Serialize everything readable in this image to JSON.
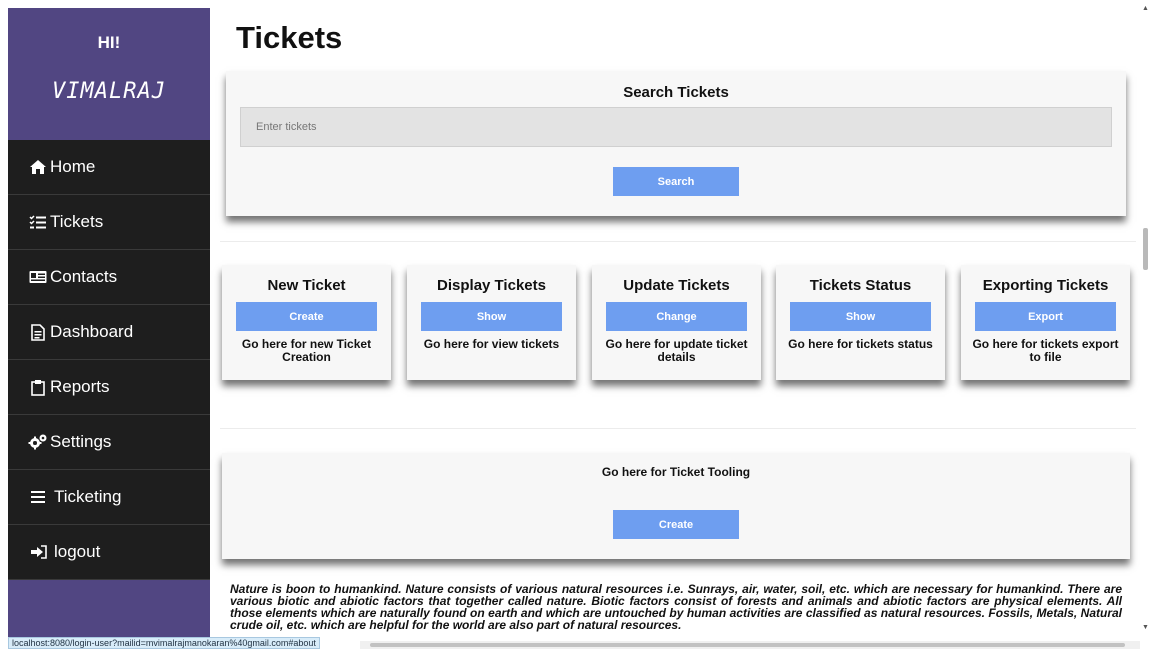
{
  "sidebar": {
    "greeting": "HI!",
    "username": "VIMALRAJ",
    "items": [
      {
        "label": "Home",
        "icon": "home-icon"
      },
      {
        "label": "Tickets",
        "icon": "list-check-icon"
      },
      {
        "label": "Contacts",
        "icon": "address-card-icon"
      },
      {
        "label": "Dashboard",
        "icon": "document-icon"
      },
      {
        "label": "Reports",
        "icon": "clipboard-icon"
      },
      {
        "label": "Settings",
        "icon": "gears-icon"
      },
      {
        "label": "Ticketing",
        "icon": "bars-icon"
      },
      {
        "label": "logout",
        "icon": "sign-out-icon"
      }
    ]
  },
  "main": {
    "title": "Tickets",
    "search": {
      "title": "Search Tickets",
      "placeholder": "Enter tickets",
      "button": "Search"
    },
    "actions": [
      {
        "title": "New Ticket",
        "button": "Create",
        "desc": "Go here for new Ticket Creation"
      },
      {
        "title": "Display Tickets",
        "button": "Show",
        "desc": "Go here for view tickets"
      },
      {
        "title": "Update Tickets",
        "button": "Change",
        "desc": "Go here for update ticket details"
      },
      {
        "title": "Tickets Status",
        "button": "Show",
        "desc": "Go here for tickets status"
      },
      {
        "title": "Exporting Tickets",
        "button": "Export",
        "desc": "Go here for tickets export to file"
      }
    ],
    "tooling": {
      "title": "Go here for Ticket Tooling",
      "button": "Create"
    },
    "nature_text": "Nature is boon to humankind. Nature consists of various natural resources i.e. Sunrays, air, water, soil, etc. which are necessary for humankind. There are various biotic and abiotic factors that together called nature. Biotic factors consist of forests and animals and abiotic factors are physical elements. All those elements which are naturally found on earth and which are untouched by human activities are classified as natural resources. Fossils, Metals, Natural crude oil, etc. which are helpful for the world are also part of natural resources."
  },
  "status_bar": {
    "url": "localhost:8080/login-user?mailid=mvimalrajmanokaran%40gmail.com#about"
  },
  "colors": {
    "sidebar_top": "#514682",
    "sidebar_nav": "#1e1e1e",
    "button_blue": "#6e9ef0"
  }
}
